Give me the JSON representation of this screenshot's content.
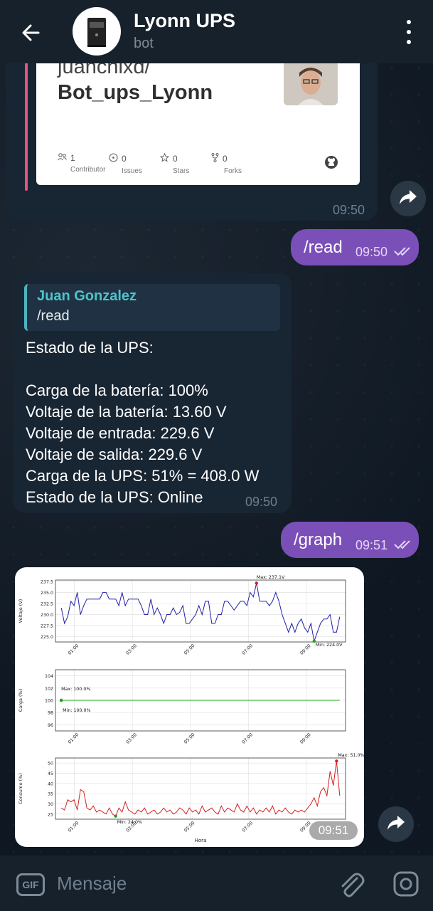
{
  "header": {
    "title": "Lyonn UPS",
    "subtitle": "bot"
  },
  "github_card": {
    "owner": "juanchixd/",
    "repo": "Bot_ups_Lyonn",
    "stats": [
      {
        "num": "1",
        "label": "Contributor",
        "icon": "people-icon"
      },
      {
        "num": "0",
        "label": "Issues",
        "icon": "issue-icon"
      },
      {
        "num": "0",
        "label": "Stars",
        "icon": "star-icon"
      },
      {
        "num": "0",
        "label": "Forks",
        "icon": "fork-icon"
      }
    ],
    "time": "09:50"
  },
  "messages": {
    "read_cmd": {
      "text": "/read",
      "time": "09:50"
    },
    "status": {
      "reply_name": "Juan Gonzalez",
      "reply_text": "/read",
      "lines": [
        "Estado de la UPS:",
        "",
        "Carga de la batería: 100%",
        "Voltaje de la batería: 13.60 V",
        "Voltaje de entrada: 229.6 V",
        "Voltaje de salida: 229.6 V",
        "Carga de la UPS: 51% = 408.0 W",
        "Estado de la UPS: Online"
      ],
      "time": "09:50"
    },
    "graph_cmd": {
      "text": "/graph",
      "time": "09:51"
    },
    "graph_time": "09:51"
  },
  "composer": {
    "placeholder": "Mensaje",
    "gif_label": "GIF"
  },
  "chart_data": [
    {
      "type": "line",
      "ylabel": "Voltaje (V)",
      "x_ticks": [
        "01:00",
        "03:00",
        "05:00",
        "07:00",
        "09:00"
      ],
      "ylim": [
        223.8,
        237.8
      ],
      "y_ticks": [
        225.0,
        227.5,
        230.0,
        232.5,
        235.0,
        237.5
      ],
      "max_label": "Max: 237.1V",
      "min_label": "Min: 224.0V",
      "color": "#1f1fa8",
      "values": [
        231.5,
        228,
        229.5,
        233,
        232,
        235,
        230,
        232,
        233.5,
        233.5,
        233.5,
        233.5,
        233.5,
        235,
        235,
        233.5,
        233.5,
        233.5,
        232,
        235,
        232,
        233.5,
        233.5,
        233.5,
        233.5,
        232,
        230,
        230,
        233.5,
        230,
        231.5,
        230,
        228,
        230,
        230,
        231.5,
        230,
        230.5,
        232,
        228,
        228,
        229,
        230,
        232,
        230,
        233,
        233,
        228,
        228,
        230,
        230,
        233,
        233,
        232,
        231,
        232,
        233,
        233,
        232,
        235,
        234,
        237.1,
        233,
        233,
        233,
        232,
        233,
        235,
        233,
        230,
        228,
        226,
        228,
        226,
        228,
        229,
        227,
        226,
        228,
        224,
        226,
        228,
        229,
        229,
        230,
        226,
        226,
        229.5
      ]
    },
    {
      "type": "line",
      "ylabel": "Carga (%)",
      "x_ticks": [
        "01:00",
        "03:00",
        "05:00",
        "07:00",
        "09:00"
      ],
      "ylim": [
        95,
        105
      ],
      "y_ticks": [
        96,
        98,
        100,
        102,
        104
      ],
      "max_label": "Max: 100.0%",
      "min_label": "Min: 100.0%",
      "color": "#1aa31a",
      "values": [
        100,
        100,
        100,
        100,
        100,
        100,
        100,
        100,
        100,
        100,
        100
      ]
    },
    {
      "type": "line",
      "ylabel": "Consumo (%)",
      "xlabel": "Hora",
      "x_ticks": [
        "01:00",
        "03:00",
        "05:00",
        "07:00",
        "09:00"
      ],
      "ylim": [
        22.5,
        52.5
      ],
      "y_ticks": [
        25,
        30,
        35,
        40,
        45,
        50
      ],
      "max_label": "Max: 51.0%",
      "min_label": "Min: 24.0%",
      "color": "#d42020",
      "values": [
        28,
        27,
        32,
        31,
        32,
        27,
        37,
        36,
        28,
        27,
        29,
        26,
        27,
        26,
        25,
        28,
        25,
        24,
        28,
        26,
        31,
        27,
        26,
        25,
        27,
        26,
        28,
        25,
        26,
        27,
        25,
        26,
        28,
        26,
        27,
        25,
        26,
        28,
        27,
        25,
        28,
        26,
        27,
        25,
        29,
        26,
        27,
        28,
        26,
        25,
        29,
        26,
        28,
        27,
        26,
        30,
        27,
        26,
        29,
        26,
        28,
        25,
        27,
        26,
        28,
        26,
        29,
        25,
        27,
        26,
        28,
        26,
        25,
        27,
        26,
        27,
        26,
        28,
        30,
        33,
        29,
        36,
        38,
        34,
        46,
        39,
        51,
        34
      ]
    }
  ]
}
